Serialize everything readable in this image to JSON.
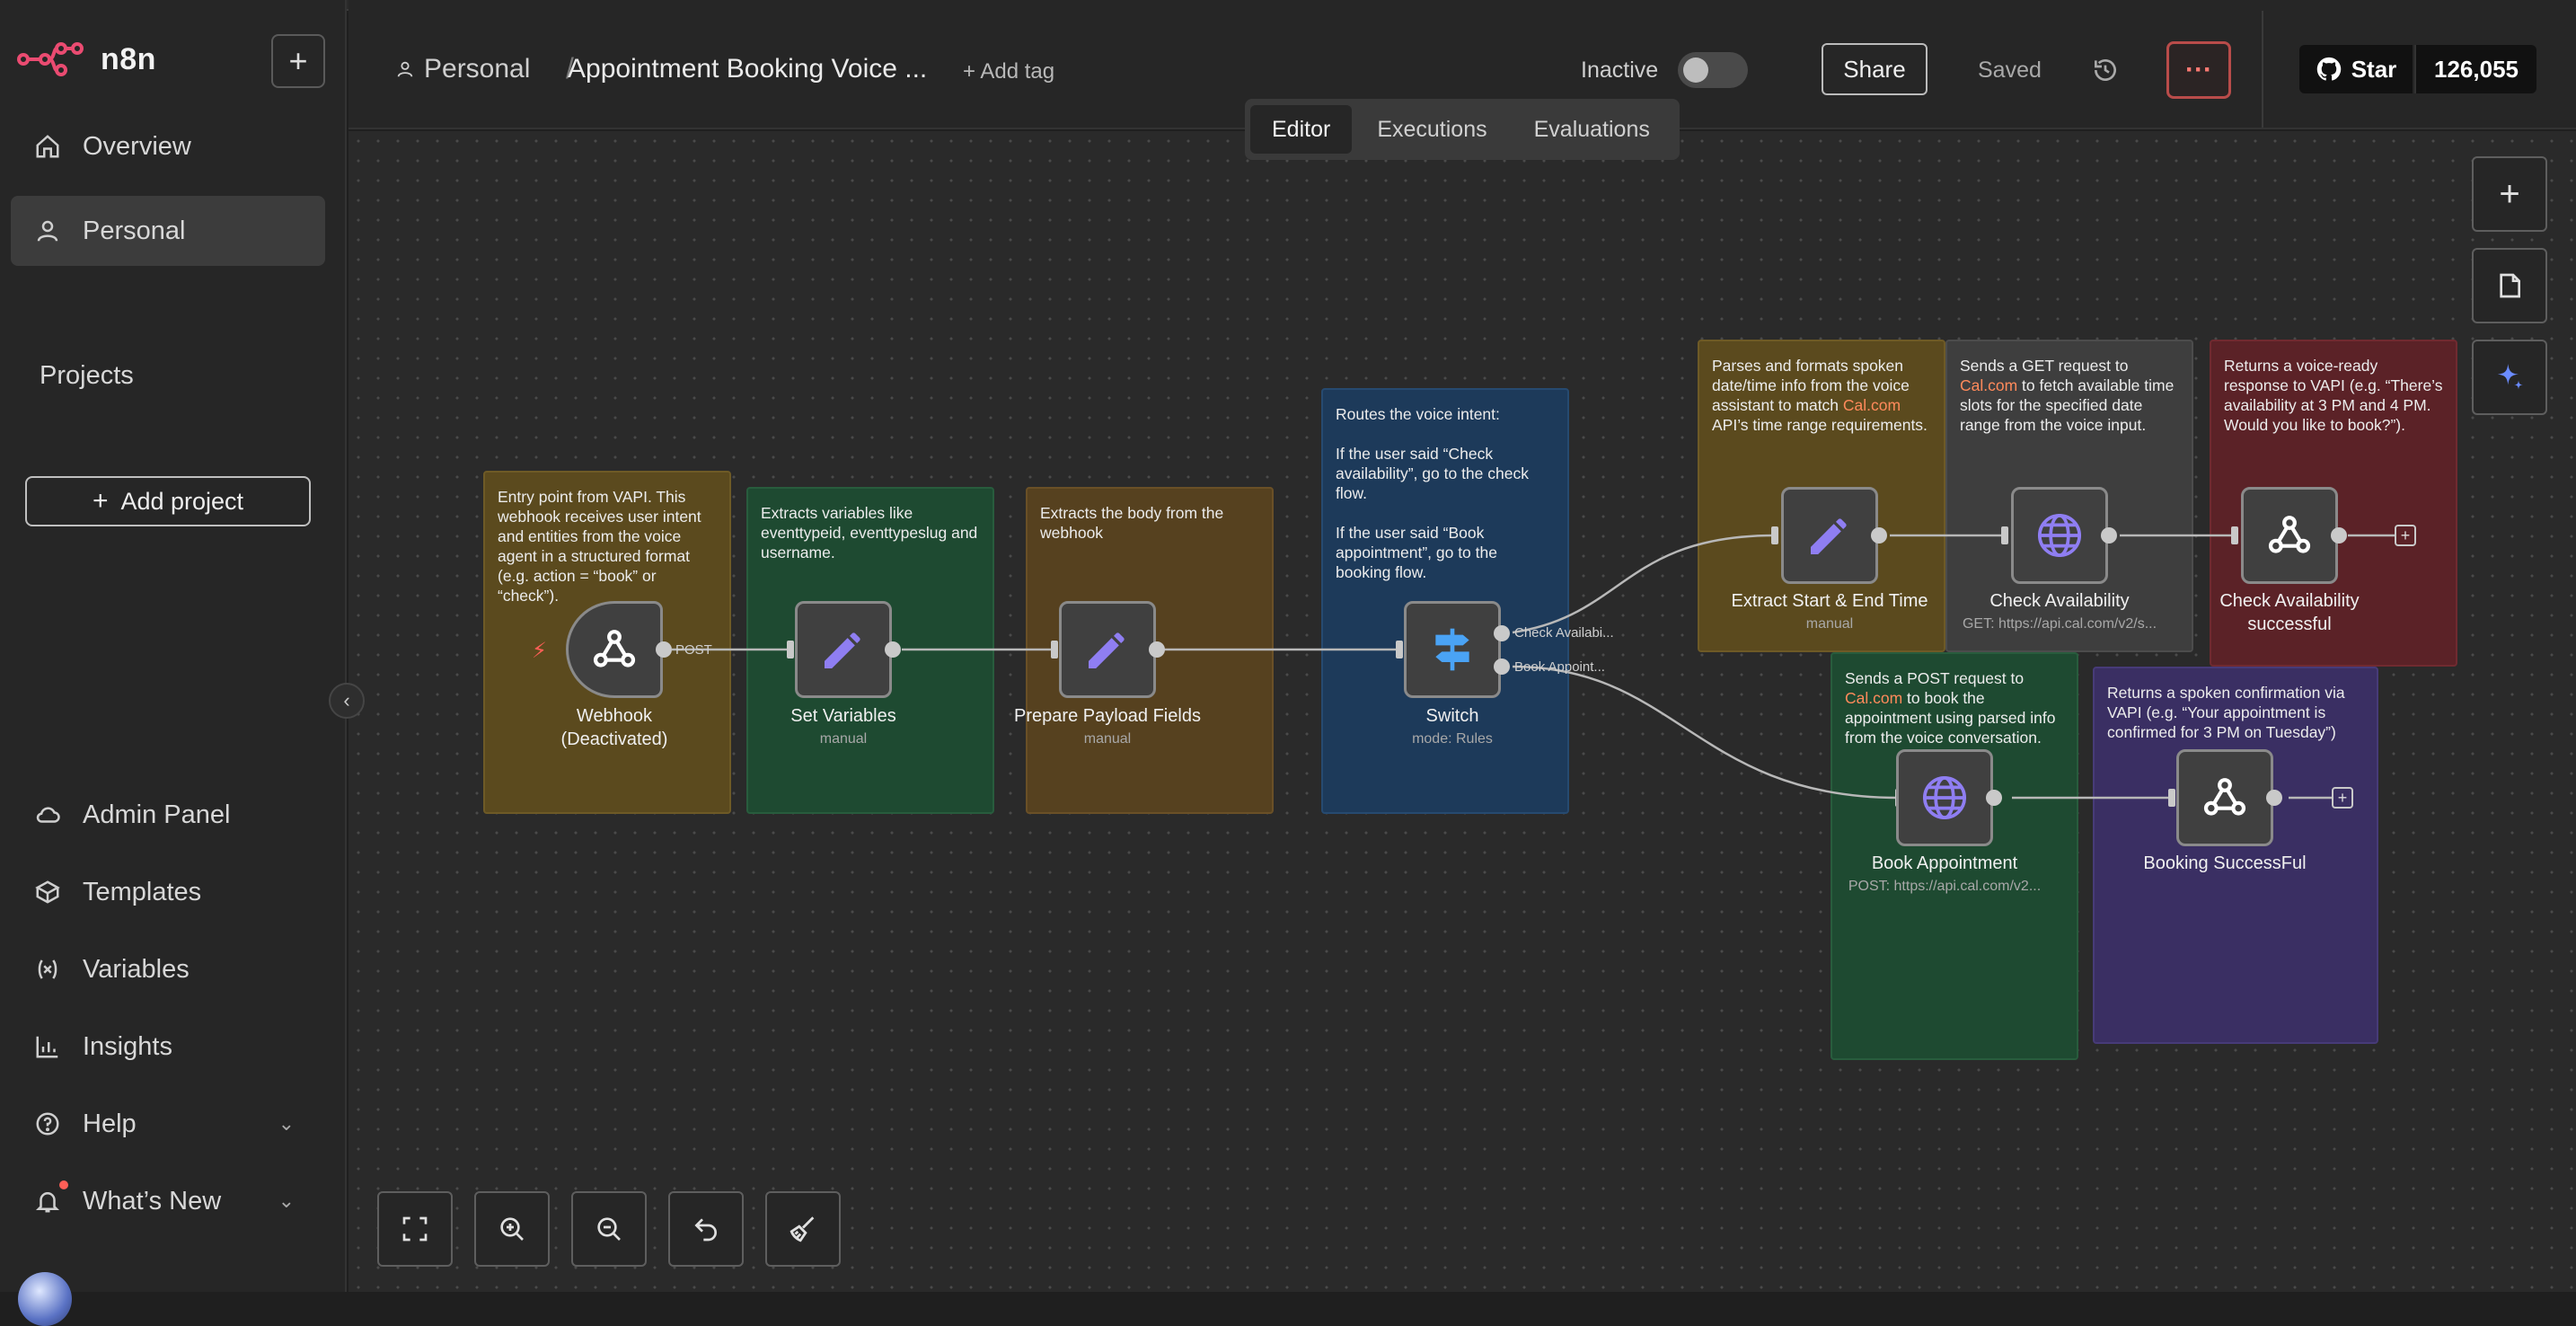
{
  "app": {
    "name": "n8n"
  },
  "sidebar": {
    "items": [
      {
        "label": "Overview",
        "icon": "home-icon"
      },
      {
        "label": "Personal",
        "icon": "user-icon"
      }
    ],
    "projects_label": "Projects",
    "add_project_label": "Add project",
    "bottom_items": [
      {
        "label": "Admin Panel",
        "icon": "cloud-icon"
      },
      {
        "label": "Templates",
        "icon": "box-icon"
      },
      {
        "label": "Variables",
        "icon": "variable-icon"
      },
      {
        "label": "Insights",
        "icon": "chart-icon"
      },
      {
        "label": "Help",
        "icon": "help-icon"
      },
      {
        "label": "What’s New",
        "icon": "bell-icon"
      }
    ]
  },
  "header": {
    "breadcrumb_project": "Personal",
    "workflow_title": "Appointment Booking Voice ...",
    "add_tag": "+ Add tag",
    "status_label": "Inactive",
    "share_label": "Share",
    "saved_label": "Saved",
    "github_star": "Star",
    "github_count": "126,055"
  },
  "tabs": [
    {
      "label": "Editor",
      "active": true
    },
    {
      "label": "Executions",
      "active": false
    },
    {
      "label": "Evaluations",
      "active": false
    }
  ],
  "sticky_notes": [
    {
      "text": "Entry point from VAPI. This webhook receives user intent and entities from the voice agent in a structured format (e.g. action = “book” or “check”).",
      "color": "#5b4a1e"
    },
    {
      "text": "Extracts variables like eventtypeid, eventtypeslug and username.",
      "color": "#1e4a31"
    },
    {
      "text": "Extracts the body from the webhook",
      "color": "#56411f"
    },
    {
      "text": "Routes the voice intent:",
      "line2": "If the user said “Check availability”, go to the check flow.",
      "line3": "If the user said “Book appointment”, go to the booking flow.",
      "color": "#1d3a5a"
    },
    {
      "pre": "Parses and formats spoken date/time info from the voice assistant to match ",
      "link": "Cal.com",
      "post": " API’s time range requirements.",
      "color": "#5b4a1e"
    },
    {
      "pre": "Sends a GET request to ",
      "link": "Cal.com",
      "post": " to fetch available time slots for the specified date range from the voice input.",
      "color": "#3e3e3e"
    },
    {
      "text": "Returns a voice-ready response to VAPI (e.g. “There’s availability at 3 PM and 4 PM. Would you like to book?”).",
      "color": "#5b2227"
    },
    {
      "pre": "Sends a POST request to ",
      "link": "Cal.com",
      "post": " to book the appointment using parsed info from the voice conversation.",
      "color": "#1e4a31"
    },
    {
      "text": "Returns a spoken confirmation via VAPI (e.g. “Your appointment is confirmed for 3 PM on Tuesday”)",
      "color": "#3a2f63"
    }
  ],
  "nodes": [
    {
      "label": "Webhook",
      "label2": "(Deactivated)",
      "icon": "webhook-icon",
      "output_label": "POST"
    },
    {
      "label": "Set Variables",
      "sub": "manual",
      "icon": "pencil-icon"
    },
    {
      "label": "Prepare Payload Fields",
      "sub": "manual",
      "icon": "pencil-icon"
    },
    {
      "label": "Switch",
      "sub": "mode: Rules",
      "icon": "switch-icon",
      "outputs": [
        "Check Availabi...",
        "Book Appoint..."
      ]
    },
    {
      "label": "Extract Start & End Time",
      "sub": "manual",
      "icon": "pencil-icon"
    },
    {
      "label": "Check Availability",
      "sub": "GET: https://api.cal.com/v2/s...",
      "icon": "globe-icon"
    },
    {
      "label": "Check Availability",
      "label2": "successful",
      "icon": "webhook-icon"
    },
    {
      "label": "Book Appointment",
      "sub": "POST: https://api.cal.com/v2...",
      "icon": "globe-icon"
    },
    {
      "label": "Booking SuccessFul",
      "icon": "webhook-icon"
    }
  ],
  "colors": {
    "accent": "#ff6f5c",
    "node_icon": "#8f7ef2",
    "switch_icon": "#4aa3f5"
  }
}
